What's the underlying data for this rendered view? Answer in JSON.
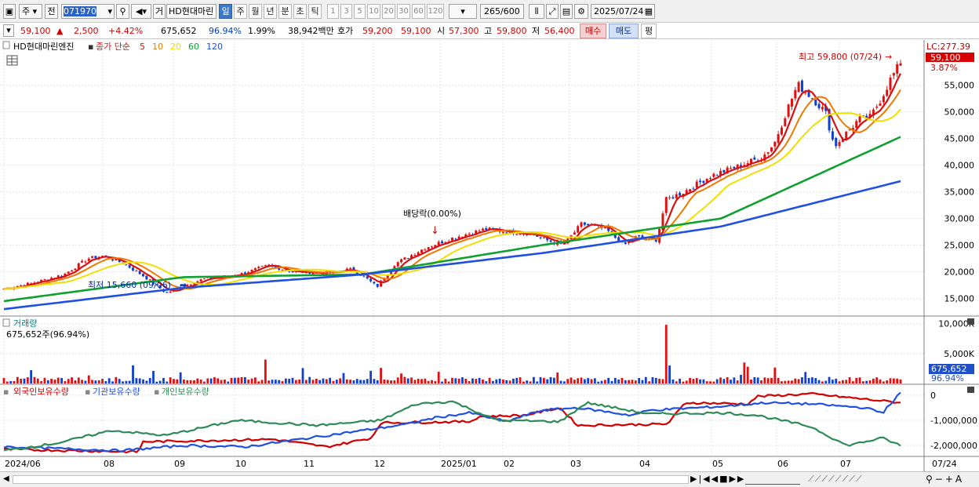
{
  "toolbar": {
    "type_label": "주",
    "prev_label": "전",
    "code_value": "071970",
    "stock_label": "거",
    "stock_name": "HD현대마린",
    "periods": [
      "일",
      "주",
      "월",
      "년",
      "분",
      "초",
      "틱"
    ],
    "active_period": "일",
    "multipliers": [
      "1",
      "3",
      "5",
      "10",
      "20",
      "30",
      "60",
      "120"
    ],
    "count_value": "265",
    "count_total": "/600",
    "date_value": "2025/07/24"
  },
  "quote": {
    "price": "59,100",
    "arrow": "▲",
    "change": "2,500",
    "change_pct": "+4.42%",
    "volume": "675,652",
    "volume_ratio": "96.94%",
    "turnover": "1.99%",
    "amount": "38,942백만",
    "hoga_label": "호가",
    "ask": "59,200",
    "bid": "59,100",
    "open_label": "시",
    "open": "57,300",
    "high_label": "고",
    "high": "59,800",
    "low_label": "저",
    "low": "56,400",
    "buy_label": "매수",
    "sell_label": "매도",
    "eval_label": "평"
  },
  "price_panel": {
    "legend_name": "HD현대마린엔진",
    "legend_ma_prefix": "종가 단순",
    "ma_labels": [
      "5",
      "10",
      "20",
      "60",
      "120"
    ],
    "ma_colors": [
      "#d81010",
      "#f07800",
      "#f0e000",
      "#10a030",
      "#2050e0"
    ],
    "max_annotation": "최고 59,800 (07/24)",
    "min_annotation": "최저 15,660 (09/06)",
    "dividend_annotation": "배당락(0.00%)",
    "lc_label": "LC:277.39",
    "last_price_tag": "59,100",
    "last_pct_tag": "3.87%",
    "y_ticks": [
      "55,000",
      "50,000",
      "45,000",
      "40,000",
      "35,000",
      "30,000",
      "25,000",
      "20,000",
      "15,000"
    ]
  },
  "volume_panel": {
    "title": "거래량",
    "current": "675,652주(96.94%)",
    "y_ticks": [
      "10,000K",
      "5,000K"
    ],
    "tag_value": "675,652",
    "tag_pct": "96.94%"
  },
  "holding_panel": {
    "legend": [
      "외국인보유수량",
      "기관보유수량",
      "개인보유수량"
    ],
    "colors": [
      "#d00000",
      "#2050e0",
      "#2e8b57"
    ],
    "y_ticks": [
      "0",
      "-1,000,000",
      "-2,000,000"
    ]
  },
  "x_axis": {
    "labels": [
      "2024/06",
      "08",
      "09",
      "10",
      "11",
      "12",
      "2025/01",
      "02",
      "03",
      "04",
      "05",
      "06",
      "07"
    ],
    "end_label": "07/24"
  },
  "chart_data": {
    "type": "line",
    "title": "",
    "x_range": [
      "2024/06",
      "2025/07/24"
    ],
    "price_ylim": [
      12000,
      62000
    ],
    "series": [
      {
        "name": "종가",
        "x": [
          "2024/06",
          "2024/07",
          "2024/08",
          "2024/09",
          "2024/10",
          "2024/11",
          "2024/12",
          "2025/01",
          "2025/02",
          "2025/03",
          "2025/04",
          "2025/05",
          "2025/06",
          "2025/07",
          "2025/07/24"
        ],
        "values": [
          17000,
          19000,
          21500,
          17000,
          19500,
          19000,
          18500,
          25000,
          27000,
          28000,
          26000,
          36000,
          44000,
          47500,
          59100
        ]
      },
      {
        "name": "120",
        "x": [
          "2024/06",
          "2024/09",
          "2024/12",
          "2025/03",
          "2025/05",
          "2025/07/24"
        ],
        "values": [
          13000,
          17000,
          19500,
          23500,
          28500,
          37000
        ]
      },
      {
        "name": "60",
        "x": [
          "2024/06",
          "2024/09",
          "2024/12",
          "2025/03",
          "2025/05",
          "2025/07/24"
        ],
        "values": [
          14500,
          19000,
          19500,
          25000,
          30000,
          45300
        ]
      }
    ],
    "annotations": [
      {
        "text": "최고 59,800 (07/24)",
        "x": "2025/07/24",
        "y": 59800
      },
      {
        "text": "최저 15,660 (09/06)",
        "x": "2024/09/06",
        "y": 15660
      },
      {
        "text": "배당락(0.00%)",
        "x": "2024/12/27",
        "y": 24000
      }
    ],
    "volume_peak": {
      "x": "2025/03",
      "value": 9800000
    },
    "volume_ylim": [
      0,
      11000000
    ],
    "holding_ylim": [
      -2400000,
      400000
    ]
  }
}
